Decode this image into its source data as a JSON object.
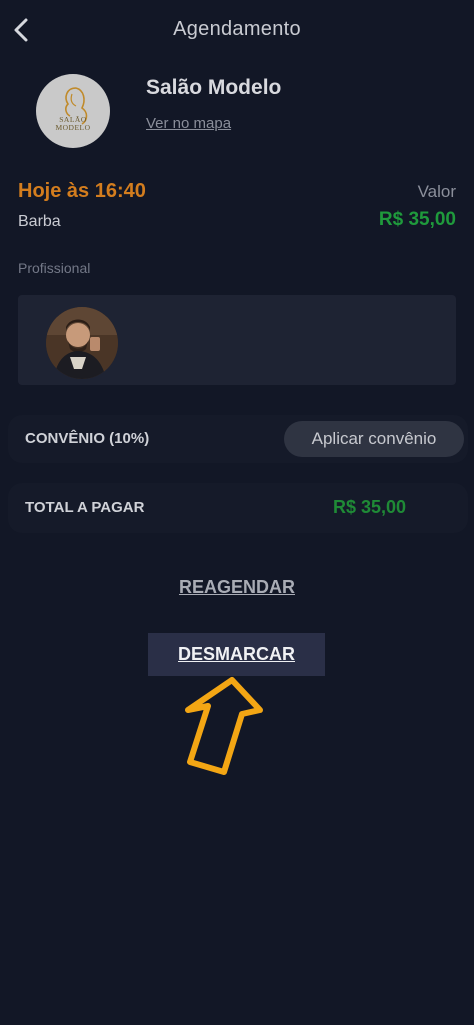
{
  "header": {
    "title": "Agendamento",
    "back_icon": "chevron-left-icon"
  },
  "salon": {
    "name": "Salão Modelo",
    "map_link": "Ver no mapa",
    "logo_text_line1": "SALÃO",
    "logo_text_line2": "MODELO"
  },
  "appointment": {
    "when": "Hoje às 16:40",
    "service": "Barba",
    "value_label": "Valor",
    "price": "R$ 35,00"
  },
  "professional": {
    "label": "Profissional"
  },
  "convenio": {
    "label": "CONVÊNIO  (10%)",
    "button": "Aplicar convênio"
  },
  "total": {
    "label": "TOTAL A PAGAR",
    "value": "R$ 35,00"
  },
  "actions": {
    "reschedule": "REAGENDAR",
    "cancel": "DESMARCAR"
  },
  "colors": {
    "background": "#121726",
    "accent_orange": "#d37d1e",
    "price_green": "#1f9a3c",
    "arrow_yellow": "#f3a614"
  }
}
